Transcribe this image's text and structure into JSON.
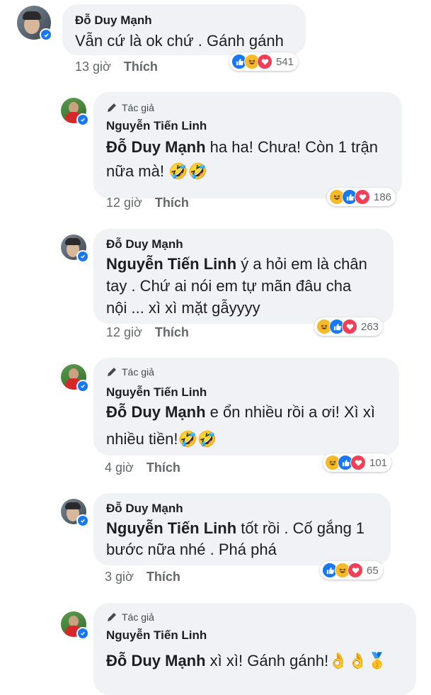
{
  "comments": [
    {
      "author": "Đỗ Duy Mạnh",
      "author_tag": "",
      "mention": "",
      "text": "Vẫn cứ là ok chứ . Gánh gánh",
      "time": "13 giờ",
      "like_label": "Thích",
      "reaction_count": "541",
      "reactions": [
        "like",
        "haha",
        "love"
      ]
    },
    {
      "author": "Nguyễn Tiến Linh",
      "author_tag": "Tác giả",
      "mention": "Đỗ Duy Mạnh",
      "text_line1": " ha ha! Chưa! Còn 1 trận",
      "text_line2": "nữa mà! 🤣🤣",
      "time": "12 giờ",
      "like_label": "Thích",
      "reaction_count": "186",
      "reactions": [
        "haha",
        "like",
        "love"
      ]
    },
    {
      "author": "Đỗ Duy Mạnh",
      "author_tag": "",
      "mention": "Nguyễn Tiến Linh",
      "text_line1": " ý a hỏi em là chân",
      "text_line2": "tay . Chứ ai nói em tự mãn đâu cha",
      "text_line3": "nội ... xì xì mặt gẫyyyy",
      "time": "12 giờ",
      "like_label": "Thích",
      "reaction_count": "263",
      "reactions": [
        "haha",
        "like",
        "love"
      ]
    },
    {
      "author": "Nguyễn Tiến Linh",
      "author_tag": "Tác giả",
      "mention": "Đỗ Duy Mạnh",
      "text_line1": " e ổn nhiều rồi a ơi! Xì xì",
      "text_line2": "nhiều tiền!🤣🤣",
      "time": "4 giờ",
      "like_label": "Thích",
      "reaction_count": "101",
      "reactions": [
        "haha",
        "like",
        "love"
      ]
    },
    {
      "author": "Đỗ Duy Mạnh",
      "author_tag": "",
      "mention": "Nguyễn Tiến Linh",
      "text_line1": " tốt rồi . Cố gắng 1",
      "text_line2": "bước nữa nhé . Phá phá",
      "time": "3 giờ",
      "like_label": "Thích",
      "reaction_count": "65",
      "reactions": [
        "like",
        "haha",
        "love"
      ]
    },
    {
      "author": "Nguyễn Tiến Linh",
      "author_tag": "Tác giả",
      "mention": "Đỗ Duy Mạnh",
      "text_line1": " xì xì! Gánh gánh!👌👌🥇"
    }
  ],
  "icons": {
    "verified": "verified-badge-icon",
    "author_tag": "pencil-icon",
    "like": "like-reaction-icon",
    "haha": "haha-reaction-icon",
    "love": "love-reaction-icon"
  },
  "colors": {
    "bubble": "#f0f2f5",
    "like_blue": "#1877f2",
    "haha_yellow": "#f7b928",
    "love_red": "#f33e58",
    "meta_gray": "#65676b"
  }
}
